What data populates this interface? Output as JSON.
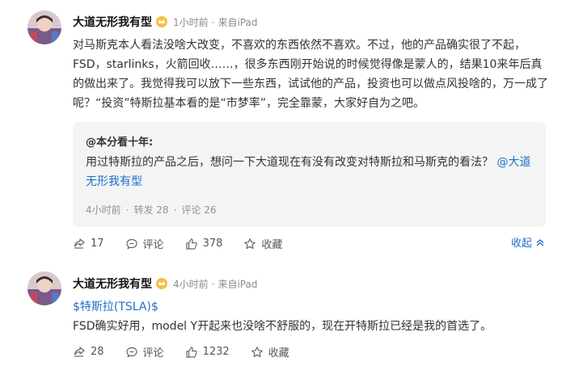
{
  "post1": {
    "author": "大道无形我有型",
    "time": "1小时前",
    "source": "来自iPad",
    "content": "对马斯克本人看法没啥大改变，不喜欢的东西依然不喜欢。不过，他的产品确实很了不起，FSD，starlinks，火箭回收……，很多东西刚开始说的时候觉得像是蒙人的，结果10来年后真的做出来了。我觉得我可以放下一些东西，试试他的产品，投资也可以做点风投啥的，万一成了呢？“投资”特斯拉基本看的是“市梦率”，完全靠蒙，大家好自为之吧。",
    "quote": {
      "author": "@本分看十年:",
      "text": "用过特斯拉的产品之后，想问一下大道现在有没有改变对特斯拉和马斯克的看法？",
      "mention": "@大道无形我有型",
      "time": "4小时前",
      "reposts_label": "转发 28",
      "comments_label": "评论 26"
    },
    "actions": {
      "share": "17",
      "comment": "评论",
      "like": "378",
      "collect": "收藏"
    },
    "collapse_label": "收起"
  },
  "post2": {
    "author": "大道无形我有型",
    "time": "4小时前",
    "source": "来自iPad",
    "stock_tag": "$特斯拉(TSLA)$",
    "content": "FSD确实好用，model Y开起来也没啥不舒服的，现在开特斯拉已经是我的首选了。",
    "actions": {
      "share": "28",
      "comment": "评论",
      "like": "1232",
      "collect": "收藏"
    }
  },
  "colors": {
    "link": "#1e6ec8",
    "meta": "#8a8a8a",
    "quote_bg": "#f4f4f4"
  },
  "icons": [
    "avatar",
    "vip-crown-icon",
    "share-icon",
    "comment-icon",
    "like-icon",
    "collect-icon",
    "chevron-up-icon"
  ]
}
